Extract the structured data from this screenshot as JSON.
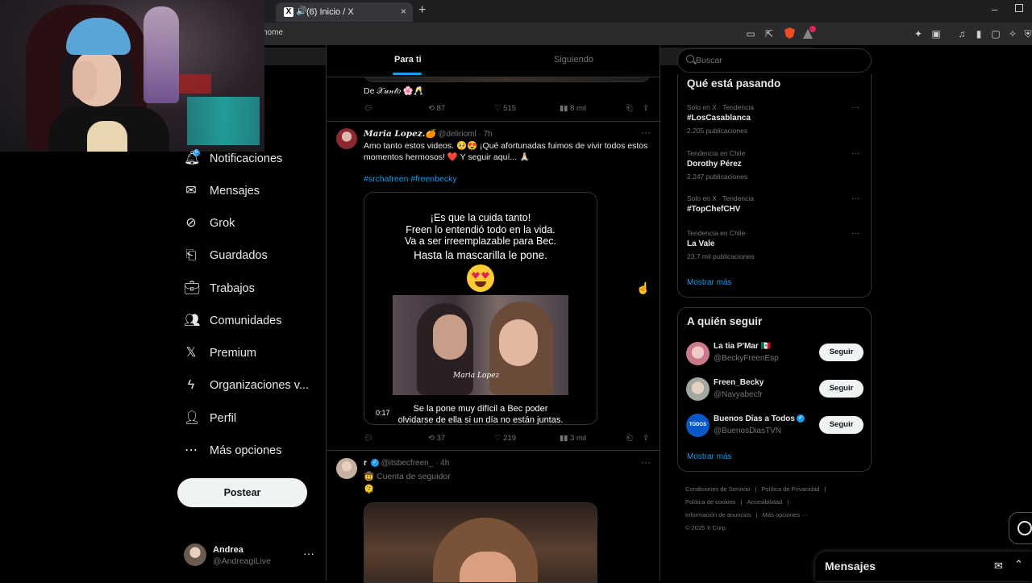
{
  "browser": {
    "tab_title": "(6) Inicio / X",
    "tab_icon": "x-logo-icon",
    "url": "home",
    "new_tab": "+",
    "close": "×",
    "minimize": "–"
  },
  "sidebar": {
    "items": [
      {
        "label": "Notificaciones",
        "icon": "bell-icon"
      },
      {
        "label": "Mensajes",
        "icon": "mail-icon"
      },
      {
        "label": "Grok",
        "icon": "grok-icon"
      },
      {
        "label": "Guardados",
        "icon": "bookmark-icon"
      },
      {
        "label": "Trabajos",
        "icon": "briefcase-icon"
      },
      {
        "label": "Comunidades",
        "icon": "people-icon"
      },
      {
        "label": "Premium",
        "icon": "x-logo-icon"
      },
      {
        "label": "Organizaciones v...",
        "icon": "lightning-icon"
      },
      {
        "label": "Perfil",
        "icon": "person-icon"
      },
      {
        "label": "Más opciones",
        "icon": "more-circle-icon"
      }
    ],
    "post_button": "Postear",
    "profile": {
      "name": "Andrea",
      "handle": "@AndreagiLive",
      "more": "···"
    }
  },
  "feed": {
    "tabs": [
      "Para ti",
      "Siguiendo"
    ],
    "prev_post": {
      "text": "De 𝒳𝓊𝓃𝓉𝑜 🌸🥂",
      "actions": {
        "replies": "",
        "reposts": "87",
        "likes": "515",
        "views": "8 mil"
      }
    },
    "post1": {
      "name": "𝑴𝒂𝒓𝒊𝒂 𝑳𝒐𝒑𝒆𝒛.🍊",
      "meta": "@delirioml · 7h",
      "text": "Amo tanto estos videos. 🥺😍 ¡Qué afortunadas fuimos de vivir todos estos momentos hermosos! ❤️ Y seguir aquí... 🙏🏻",
      "hashtags": "#srchafreen #freenbecky",
      "media_lines": [
        "¡Es que la cuida tanto!",
        "Freen lo entendió todo en la vida.",
        "Va a ser irreemplazable para Bec.",
        "Hasta la mascarilla le pone."
      ],
      "media_caption": [
        "Se la pone muy difícil a Bec poder",
        "olvidarse de ella si un día no están juntas."
      ],
      "watermark": "Maria Lopez",
      "duration": "0:17",
      "actions": {
        "replies": "",
        "reposts": "37",
        "likes": "219",
        "views": "3 mil"
      }
    },
    "post2": {
      "name": "r",
      "meta": "@itsbecfreen_ · 4h",
      "subscribe": "🤠 Cuenta de seguidor",
      "text": "🫠"
    },
    "more": "···"
  },
  "right": {
    "search_placeholder": "Buscar",
    "trends_title": "Qué está pasando",
    "trends": [
      {
        "meta": "Solo en X · Tendencia",
        "name": "#LosCasablanca",
        "count": "2.205 publicaciones"
      },
      {
        "meta": "Tendencia en Chile",
        "name": "Dorothy Pérez",
        "count": "2.247 publicaciones"
      },
      {
        "meta": "Solo en X · Tendencia",
        "name": "#TopChefCHV",
        "count": ""
      },
      {
        "meta": "Tendencia en Chile",
        "name": "La Vale",
        "count": "23,7 mil publicaciones"
      }
    ],
    "trends_more": "Mostrar más",
    "follow_title": "A quién seguir",
    "follow": [
      {
        "name": "La tia P'Mar 🇲🇽",
        "handle": "@BeckyFreenEsp",
        "button": "Seguir"
      },
      {
        "name": "Freen_Becky",
        "handle": "@Navyabecfr",
        "button": "Seguir"
      },
      {
        "name": "Buenos Días a Todos",
        "handle": "@BuenosDiasTVN",
        "button": "Seguir"
      }
    ],
    "follow_more": "Mostrar más",
    "footer": [
      "Condiciones de Servicio",
      "|",
      "Política de Privacidad",
      "|",
      "Política de cookies",
      "|",
      "Accesibilidad",
      "|",
      "Información de anuncios",
      "|",
      "Más opciones ···",
      "© 2025 X Corp."
    ]
  },
  "messages_bar": {
    "title": "Mensajes"
  },
  "colors": {
    "accent": "#1d9bf0",
    "background": "#000000",
    "text": "#e7e9ea",
    "muted": "#71767b"
  }
}
